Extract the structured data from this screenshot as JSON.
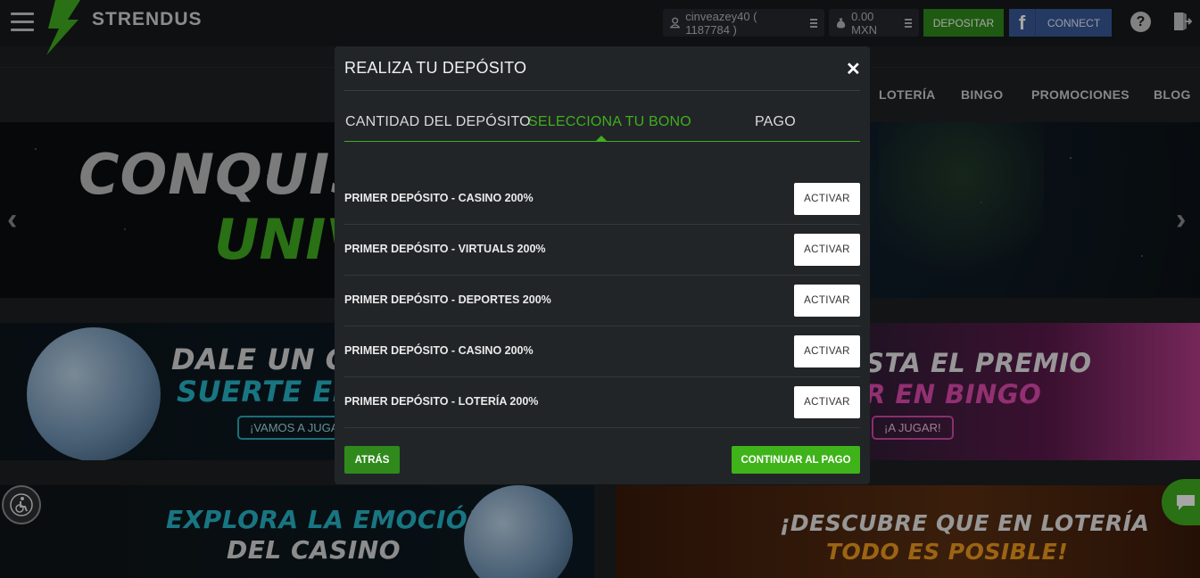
{
  "header": {
    "brand": "STRENDUS",
    "user": "cinveazey40 ( 1187784 )",
    "balance": "0.00 MXN",
    "deposit_label": "DEPOSITAR",
    "connect_label": "CONNECT",
    "facebook_glyph": "f",
    "help_glyph": "?"
  },
  "nav": {
    "items": [
      "LOTERÍA",
      "BINGO",
      "PROMOCIONES",
      "BLOG"
    ]
  },
  "hero": {
    "line1": "CONQUISTA",
    "line2": "UNIV",
    "prev_glyph": "‹",
    "next_glyph": "›"
  },
  "promos": {
    "ruleta_line1": "DALE UN GIR",
    "ruleta_line2": "SUERTE EN S",
    "ruleta_cta": "¡VAMOS A JUGAR",
    "bingo_line1": "STA EL PREMIO",
    "bingo_line2": "R EN BINGO",
    "bingo_cta": "¡A JUGAR!",
    "casino_line1": "EXPLORA LA EMOCIÓN",
    "casino_line2": "DEL CASINO",
    "loteria_line1": "¡DESCUBRE QUE EN LOTERÍA",
    "loteria_line2": "TODO ES POSIBLE!"
  },
  "modal": {
    "title": "REALIZA TU DEPÓSITO",
    "close_glyph": "✕",
    "steps": [
      "CANTIDAD DEL DEPÓSITO",
      "SELECCIONA TU BONO",
      "PAGO"
    ],
    "active_step": 1,
    "bonuses": [
      {
        "label": "PRIMER DEPÓSITO - CASINO 200%",
        "action": "ACTIVAR"
      },
      {
        "label": "PRIMER DEPÓSITO - VIRTUALS 200%",
        "action": "ACTIVAR"
      },
      {
        "label": "PRIMER DEPÓSITO - DEPORTES 200%",
        "action": "ACTIVAR"
      },
      {
        "label": "PRIMER DEPÓSITO - CASINO 200%",
        "action": "ACTIVAR"
      },
      {
        "label": "PRIMER DEPÓSITO - LOTERÍA 200%",
        "action": "ACTIVAR"
      }
    ],
    "back_label": "ATRÁS",
    "continue_label": "CONTINUAR AL PAGO"
  },
  "colors": {
    "accent_green": "#3fae1f",
    "deposit_green": "#2f8a1b",
    "facebook_blue": "#3a5a98",
    "modal_bg": "#222528"
  }
}
